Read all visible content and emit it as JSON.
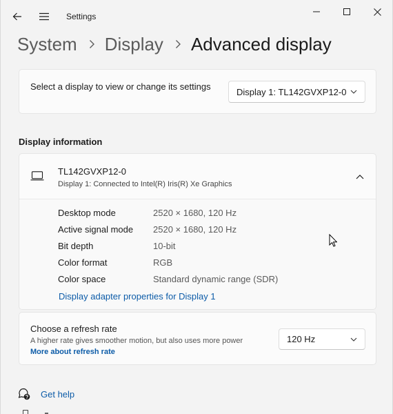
{
  "app": {
    "title": "Settings"
  },
  "window_controls": {
    "minimize": "minimize-icon",
    "maximize": "maximize-icon",
    "close": "close-icon"
  },
  "breadcrumb": {
    "items": [
      "System",
      "Display"
    ],
    "current": "Advanced display"
  },
  "display_select": {
    "label": "Select a display to view or change its settings",
    "selected": "Display 1: TL142GVXP12-0"
  },
  "display_information": {
    "heading": "Display information",
    "name": "TL142GVXP12-0",
    "subtitle": "Display 1: Connected to Intel(R) Iris(R) Xe Graphics",
    "expanded": true,
    "properties": [
      {
        "label": "Desktop mode",
        "value": "2520 × 1680, 120 Hz"
      },
      {
        "label": "Active signal mode",
        "value": "2520 × 1680, 120 Hz"
      },
      {
        "label": "Bit depth",
        "value": "10-bit"
      },
      {
        "label": "Color format",
        "value": "RGB"
      },
      {
        "label": "Color space",
        "value": "Standard dynamic range (SDR)"
      }
    ],
    "adapter_link": "Display adapter properties for Display 1"
  },
  "refresh_rate": {
    "title": "Choose a refresh rate",
    "description": "A higher rate gives smoother motion, but also uses more power",
    "link": "More about refresh rate",
    "selected": "120 Hz"
  },
  "help": {
    "label": "Get help"
  },
  "colors": {
    "accent": "#0d5ca8",
    "background": "#f3f3f3",
    "card": "#fbfbfb"
  }
}
